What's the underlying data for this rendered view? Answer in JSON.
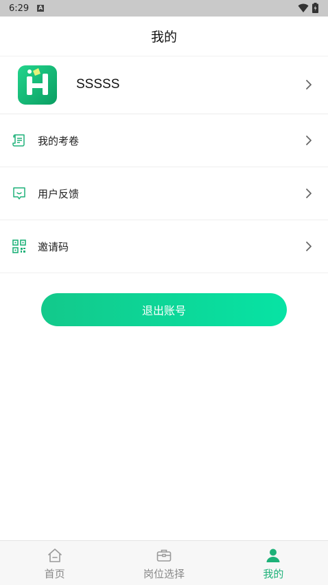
{
  "status": {
    "time": "6:29",
    "badge": "A"
  },
  "header": {
    "title": "我的"
  },
  "profile": {
    "name": "SSSSS"
  },
  "menu": [
    {
      "label": "我的考卷",
      "icon": "document-icon"
    },
    {
      "label": "用户反馈",
      "icon": "feedback-icon"
    },
    {
      "label": "邀请码",
      "icon": "qr-code-icon"
    }
  ],
  "logout": {
    "label": "退出账号"
  },
  "tabs": [
    {
      "label": "首页",
      "icon": "home-icon",
      "active": false
    },
    {
      "label": "岗位选择",
      "icon": "briefcase-icon",
      "active": false
    },
    {
      "label": "我的",
      "icon": "user-icon",
      "active": true
    }
  ],
  "colors": {
    "accent": "#1db178",
    "button_start": "#13c98b",
    "button_end": "#07e3a4"
  }
}
